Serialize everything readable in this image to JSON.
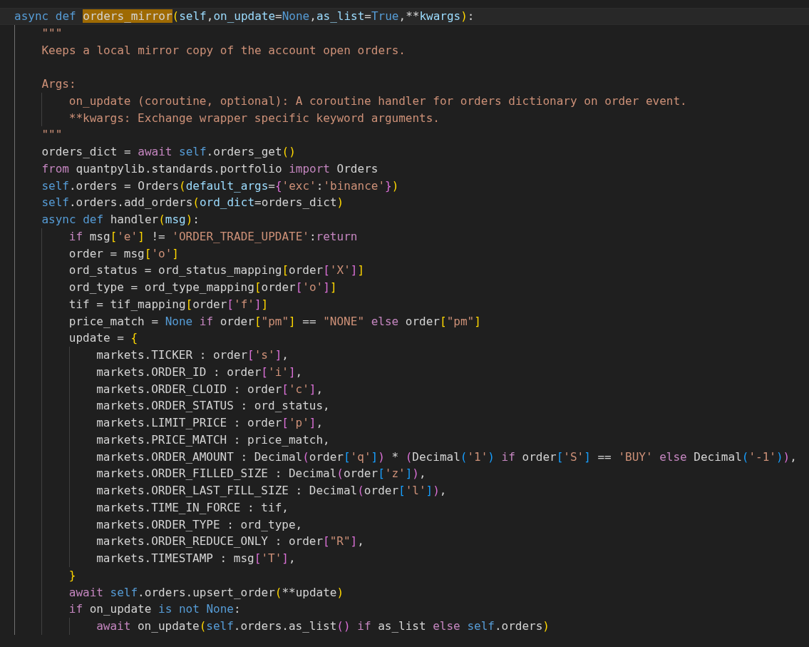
{
  "editor": {
    "lines": [
      {
        "current": true,
        "tokens": [
          {
            "kind": "keyword",
            "text": "async def "
          },
          {
            "kind": "match",
            "text": "orders_mirror"
          },
          {
            "kind": "bracket1",
            "text": "("
          },
          {
            "kind": "param",
            "text": "self"
          },
          {
            "kind": "plain",
            "text": ","
          },
          {
            "kind": "param",
            "text": "on_update"
          },
          {
            "kind": "plain",
            "text": "="
          },
          {
            "kind": "keyword",
            "text": "None"
          },
          {
            "kind": "plain",
            "text": ","
          },
          {
            "kind": "param",
            "text": "as_list"
          },
          {
            "kind": "plain",
            "text": "="
          },
          {
            "kind": "keyword",
            "text": "True"
          },
          {
            "kind": "plain",
            "text": ",**"
          },
          {
            "kind": "param",
            "text": "kwargs"
          },
          {
            "kind": "bracket1",
            "text": ")"
          },
          {
            "kind": "plain",
            "text": ":"
          }
        ],
        "children": [
          {
            "current": false,
            "tokens": [
              {
                "kind": "string",
                "text": "\"\"\""
              }
            ]
          },
          {
            "current": false,
            "tokens": [
              {
                "kind": "string",
                "text": "Keeps a local mirror copy of the account open orders."
              }
            ]
          },
          {
            "current": false
          },
          {
            "current": false,
            "tokens": [
              {
                "kind": "string",
                "text": "Args:"
              }
            ],
            "children": [
              {
                "current": false,
                "tokens": [
                  {
                    "kind": "string",
                    "text": "on_update (coroutine, optional): A coroutine handler for orders dictionary on order event."
                  }
                ]
              },
              {
                "current": false,
                "tokens": [
                  {
                    "kind": "string",
                    "text": "**kwargs: Exchange wrapper specific keyword arguments."
                  }
                ]
              }
            ]
          },
          {
            "current": false,
            "tokens": [
              {
                "kind": "string",
                "text": "\"\"\""
              }
            ]
          },
          {
            "current": false,
            "tokens": [
              {
                "kind": "plain",
                "text": "orders_dict = "
              },
              {
                "kind": "control",
                "text": "await "
              },
              {
                "kind": "keyword",
                "text": "self"
              },
              {
                "kind": "plain",
                "text": ".orders_get"
              },
              {
                "kind": "bracket1",
                "text": "()"
              }
            ]
          },
          {
            "current": false,
            "tokens": [
              {
                "kind": "control",
                "text": "from"
              },
              {
                "kind": "plain",
                "text": " quantpylib.standards.portfolio "
              },
              {
                "kind": "control",
                "text": "import"
              },
              {
                "kind": "plain",
                "text": " Orders"
              }
            ]
          },
          {
            "current": false,
            "tokens": [
              {
                "kind": "keyword",
                "text": "self"
              },
              {
                "kind": "plain",
                "text": ".orders = Orders"
              },
              {
                "kind": "bracket1",
                "text": "("
              },
              {
                "kind": "param",
                "text": "default_args"
              },
              {
                "kind": "plain",
                "text": "="
              },
              {
                "kind": "bracket2",
                "text": "{"
              },
              {
                "kind": "string",
                "text": "'exc'"
              },
              {
                "kind": "plain",
                "text": ":"
              },
              {
                "kind": "string",
                "text": "'binance'"
              },
              {
                "kind": "bracket2",
                "text": "}"
              },
              {
                "kind": "bracket1",
                "text": ")"
              }
            ]
          },
          {
            "current": false,
            "tokens": [
              {
                "kind": "keyword",
                "text": "self"
              },
              {
                "kind": "plain",
                "text": ".orders.add_orders"
              },
              {
                "kind": "bracket1",
                "text": "("
              },
              {
                "kind": "param",
                "text": "ord_dict"
              },
              {
                "kind": "plain",
                "text": "=orders_dict"
              },
              {
                "kind": "bracket1",
                "text": ")"
              }
            ]
          },
          {
            "current": false,
            "tokens": [
              {
                "kind": "keyword",
                "text": "async def "
              },
              {
                "kind": "plain",
                "text": "handler"
              },
              {
                "kind": "bracket1",
                "text": "("
              },
              {
                "kind": "param",
                "text": "msg"
              },
              {
                "kind": "bracket1",
                "text": ")"
              },
              {
                "kind": "plain",
                "text": ":"
              }
            ],
            "children": [
              {
                "current": false,
                "tokens": [
                  {
                    "kind": "control",
                    "text": "if"
                  },
                  {
                    "kind": "plain",
                    "text": " msg"
                  },
                  {
                    "kind": "bracket1",
                    "text": "["
                  },
                  {
                    "kind": "string",
                    "text": "'e'"
                  },
                  {
                    "kind": "bracket1",
                    "text": "]"
                  },
                  {
                    "kind": "plain",
                    "text": " != "
                  },
                  {
                    "kind": "string",
                    "text": "'ORDER_TRADE_UPDATE'"
                  },
                  {
                    "kind": "plain",
                    "text": ":"
                  },
                  {
                    "kind": "control",
                    "text": "return"
                  }
                ]
              },
              {
                "current": false,
                "tokens": [
                  {
                    "kind": "plain",
                    "text": "order = msg"
                  },
                  {
                    "kind": "bracket1",
                    "text": "["
                  },
                  {
                    "kind": "string",
                    "text": "'o'"
                  },
                  {
                    "kind": "bracket1",
                    "text": "]"
                  }
                ]
              },
              {
                "current": false,
                "tokens": [
                  {
                    "kind": "plain",
                    "text": "ord_status = ord_status_mapping"
                  },
                  {
                    "kind": "bracket1",
                    "text": "["
                  },
                  {
                    "kind": "plain",
                    "text": "order"
                  },
                  {
                    "kind": "bracket2",
                    "text": "["
                  },
                  {
                    "kind": "string",
                    "text": "'X'"
                  },
                  {
                    "kind": "bracket2",
                    "text": "]"
                  },
                  {
                    "kind": "bracket1",
                    "text": "]"
                  }
                ]
              },
              {
                "current": false,
                "tokens": [
                  {
                    "kind": "plain",
                    "text": "ord_type = ord_type_mapping"
                  },
                  {
                    "kind": "bracket1",
                    "text": "["
                  },
                  {
                    "kind": "plain",
                    "text": "order"
                  },
                  {
                    "kind": "bracket2",
                    "text": "["
                  },
                  {
                    "kind": "string",
                    "text": "'o'"
                  },
                  {
                    "kind": "bracket2",
                    "text": "]"
                  },
                  {
                    "kind": "bracket1",
                    "text": "]"
                  }
                ]
              },
              {
                "current": false,
                "tokens": [
                  {
                    "kind": "plain",
                    "text": "tif = tif_mapping"
                  },
                  {
                    "kind": "bracket1",
                    "text": "["
                  },
                  {
                    "kind": "plain",
                    "text": "order"
                  },
                  {
                    "kind": "bracket2",
                    "text": "["
                  },
                  {
                    "kind": "string",
                    "text": "'f'"
                  },
                  {
                    "kind": "bracket2",
                    "text": "]"
                  },
                  {
                    "kind": "bracket1",
                    "text": "]"
                  }
                ]
              },
              {
                "current": false,
                "tokens": [
                  {
                    "kind": "plain",
                    "text": "price_match = "
                  },
                  {
                    "kind": "keyword",
                    "text": "None "
                  },
                  {
                    "kind": "control",
                    "text": "if"
                  },
                  {
                    "kind": "plain",
                    "text": " order"
                  },
                  {
                    "kind": "bracket1",
                    "text": "["
                  },
                  {
                    "kind": "string",
                    "text": "\"pm\""
                  },
                  {
                    "kind": "bracket1",
                    "text": "]"
                  },
                  {
                    "kind": "plain",
                    "text": " == "
                  },
                  {
                    "kind": "string",
                    "text": "\"NONE\" "
                  },
                  {
                    "kind": "control",
                    "text": "else"
                  },
                  {
                    "kind": "plain",
                    "text": " order"
                  },
                  {
                    "kind": "bracket1",
                    "text": "["
                  },
                  {
                    "kind": "string",
                    "text": "\"pm\""
                  },
                  {
                    "kind": "bracket1",
                    "text": "]"
                  }
                ]
              },
              {
                "current": false,
                "tokens": [
                  {
                    "kind": "plain",
                    "text": "update = "
                  },
                  {
                    "kind": "bracket1",
                    "text": "{"
                  }
                ],
                "children": [
                  {
                    "current": false,
                    "tokens": [
                      {
                        "kind": "plain",
                        "text": "markets.TICKER : order"
                      },
                      {
                        "kind": "bracket2",
                        "text": "["
                      },
                      {
                        "kind": "string",
                        "text": "'s'"
                      },
                      {
                        "kind": "bracket2",
                        "text": "]"
                      },
                      {
                        "kind": "plain",
                        "text": ","
                      }
                    ]
                  },
                  {
                    "current": false,
                    "tokens": [
                      {
                        "kind": "plain",
                        "text": "markets.ORDER_ID : order"
                      },
                      {
                        "kind": "bracket2",
                        "text": "["
                      },
                      {
                        "kind": "string",
                        "text": "'i'"
                      },
                      {
                        "kind": "bracket2",
                        "text": "]"
                      },
                      {
                        "kind": "plain",
                        "text": ","
                      }
                    ]
                  },
                  {
                    "current": false,
                    "tokens": [
                      {
                        "kind": "plain",
                        "text": "markets.ORDER_CLOID : order"
                      },
                      {
                        "kind": "bracket2",
                        "text": "["
                      },
                      {
                        "kind": "string",
                        "text": "'c'"
                      },
                      {
                        "kind": "bracket2",
                        "text": "]"
                      },
                      {
                        "kind": "plain",
                        "text": ","
                      }
                    ]
                  },
                  {
                    "current": false,
                    "tokens": [
                      {
                        "kind": "plain",
                        "text": "markets.ORDER_STATUS : ord_status,"
                      }
                    ]
                  },
                  {
                    "current": false,
                    "tokens": [
                      {
                        "kind": "plain",
                        "text": "markets.LIMIT_PRICE : order"
                      },
                      {
                        "kind": "bracket2",
                        "text": "["
                      },
                      {
                        "kind": "string",
                        "text": "'p'"
                      },
                      {
                        "kind": "bracket2",
                        "text": "]"
                      },
                      {
                        "kind": "plain",
                        "text": ","
                      }
                    ]
                  },
                  {
                    "current": false,
                    "tokens": [
                      {
                        "kind": "plain",
                        "text": "markets.PRICE_MATCH : price_match,"
                      }
                    ]
                  },
                  {
                    "current": false,
                    "tokens": [
                      {
                        "kind": "plain",
                        "text": "markets.ORDER_AMOUNT : Decimal"
                      },
                      {
                        "kind": "bracket2",
                        "text": "("
                      },
                      {
                        "kind": "plain",
                        "text": "order"
                      },
                      {
                        "kind": "bracket3",
                        "text": "["
                      },
                      {
                        "kind": "string",
                        "text": "'q'"
                      },
                      {
                        "kind": "bracket3",
                        "text": "]"
                      },
                      {
                        "kind": "bracket2",
                        "text": ")"
                      },
                      {
                        "kind": "plain",
                        "text": " * "
                      },
                      {
                        "kind": "bracket2",
                        "text": "("
                      },
                      {
                        "kind": "plain",
                        "text": "Decimal"
                      },
                      {
                        "kind": "bracket3",
                        "text": "("
                      },
                      {
                        "kind": "string",
                        "text": "'1'"
                      },
                      {
                        "kind": "bracket3",
                        "text": ") "
                      },
                      {
                        "kind": "control",
                        "text": "if"
                      },
                      {
                        "kind": "plain",
                        "text": " order"
                      },
                      {
                        "kind": "bracket3",
                        "text": "["
                      },
                      {
                        "kind": "string",
                        "text": "'S'"
                      },
                      {
                        "kind": "bracket3",
                        "text": "]"
                      },
                      {
                        "kind": "plain",
                        "text": " == "
                      },
                      {
                        "kind": "string",
                        "text": "'BUY' "
                      },
                      {
                        "kind": "control",
                        "text": "else"
                      },
                      {
                        "kind": "plain",
                        "text": " Decimal"
                      },
                      {
                        "kind": "bracket3",
                        "text": "("
                      },
                      {
                        "kind": "string",
                        "text": "'-1'"
                      },
                      {
                        "kind": "bracket3",
                        "text": ")"
                      },
                      {
                        "kind": "bracket2",
                        "text": ")"
                      },
                      {
                        "kind": "plain",
                        "text": ","
                      }
                    ]
                  },
                  {
                    "current": false,
                    "tokens": [
                      {
                        "kind": "plain",
                        "text": "markets.ORDER_FILLED_SIZE : Decimal"
                      },
                      {
                        "kind": "bracket2",
                        "text": "("
                      },
                      {
                        "kind": "plain",
                        "text": "order"
                      },
                      {
                        "kind": "bracket3",
                        "text": "["
                      },
                      {
                        "kind": "string",
                        "text": "'z'"
                      },
                      {
                        "kind": "bracket3",
                        "text": "]"
                      },
                      {
                        "kind": "bracket2",
                        "text": ")"
                      },
                      {
                        "kind": "plain",
                        "text": ","
                      }
                    ]
                  },
                  {
                    "current": false,
                    "tokens": [
                      {
                        "kind": "plain",
                        "text": "markets.ORDER_LAST_FILL_SIZE : Decimal"
                      },
                      {
                        "kind": "bracket2",
                        "text": "("
                      },
                      {
                        "kind": "plain",
                        "text": "order"
                      },
                      {
                        "kind": "bracket3",
                        "text": "["
                      },
                      {
                        "kind": "string",
                        "text": "'l'"
                      },
                      {
                        "kind": "bracket3",
                        "text": "]"
                      },
                      {
                        "kind": "bracket2",
                        "text": ")"
                      },
                      {
                        "kind": "plain",
                        "text": ","
                      }
                    ]
                  },
                  {
                    "current": false,
                    "tokens": [
                      {
                        "kind": "plain",
                        "text": "markets.TIME_IN_FORCE : tif,"
                      }
                    ]
                  },
                  {
                    "current": false,
                    "tokens": [
                      {
                        "kind": "plain",
                        "text": "markets.ORDER_TYPE : ord_type,"
                      }
                    ]
                  },
                  {
                    "current": false,
                    "tokens": [
                      {
                        "kind": "plain",
                        "text": "markets.ORDER_REDUCE_ONLY : order"
                      },
                      {
                        "kind": "bracket2",
                        "text": "["
                      },
                      {
                        "kind": "string",
                        "text": "\"R\""
                      },
                      {
                        "kind": "bracket2",
                        "text": "]"
                      },
                      {
                        "kind": "plain",
                        "text": ","
                      }
                    ]
                  },
                  {
                    "current": false,
                    "tokens": [
                      {
                        "kind": "plain",
                        "text": "markets.TIMESTAMP : msg"
                      },
                      {
                        "kind": "bracket2",
                        "text": "["
                      },
                      {
                        "kind": "string",
                        "text": "'T'"
                      },
                      {
                        "kind": "bracket2",
                        "text": "]"
                      },
                      {
                        "kind": "plain",
                        "text": ","
                      }
                    ]
                  }
                ]
              },
              {
                "current": false,
                "tokens": [
                  {
                    "kind": "bracket1",
                    "text": "}"
                  }
                ]
              },
              {
                "current": false,
                "tokens": [
                  {
                    "kind": "control",
                    "text": "await "
                  },
                  {
                    "kind": "keyword",
                    "text": "self"
                  },
                  {
                    "kind": "plain",
                    "text": ".orders.upsert_order"
                  },
                  {
                    "kind": "bracket1",
                    "text": "("
                  },
                  {
                    "kind": "plain",
                    "text": "**update"
                  },
                  {
                    "kind": "bracket1",
                    "text": ")"
                  }
                ]
              },
              {
                "current": false,
                "tokens": [
                  {
                    "kind": "control",
                    "text": "if"
                  },
                  {
                    "kind": "plain",
                    "text": " on_update "
                  },
                  {
                    "kind": "keyword",
                    "text": "is not "
                  },
                  {
                    "kind": "keyword",
                    "text": "None"
                  },
                  {
                    "kind": "plain",
                    "text": ":"
                  }
                ],
                "children": [
                  {
                    "current": false,
                    "tokens": [
                      {
                        "kind": "control",
                        "text": "await"
                      },
                      {
                        "kind": "plain",
                        "text": " on_update"
                      },
                      {
                        "kind": "bracket1",
                        "text": "("
                      },
                      {
                        "kind": "keyword",
                        "text": "self"
                      },
                      {
                        "kind": "plain",
                        "text": ".orders.as_list"
                      },
                      {
                        "kind": "bracket2",
                        "text": "() "
                      },
                      {
                        "kind": "control",
                        "text": "if"
                      },
                      {
                        "kind": "plain",
                        "text": " as_list "
                      },
                      {
                        "kind": "control",
                        "text": "else "
                      },
                      {
                        "kind": "keyword",
                        "text": "self"
                      },
                      {
                        "kind": "plain",
                        "text": ".orders"
                      },
                      {
                        "kind": "bracket1",
                        "text": ")"
                      }
                    ]
                  }
                ]
              }
            ]
          }
        ]
      }
    ]
  }
}
